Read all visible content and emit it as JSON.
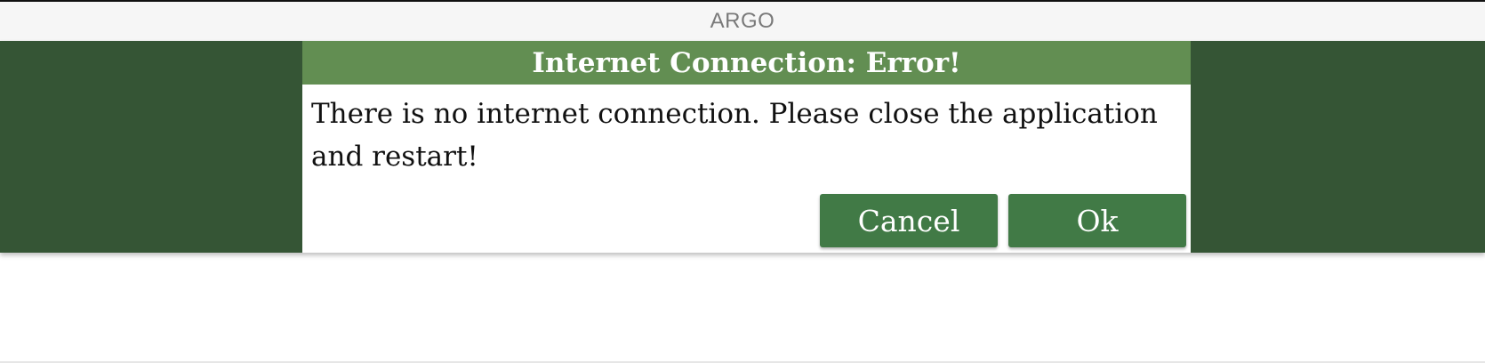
{
  "window": {
    "title": "ARGO"
  },
  "colors": {
    "app_background": "#355535",
    "dialog_header": "#628e52",
    "button": "#417a46"
  },
  "dialog": {
    "title": "Internet Connection: Error!",
    "message": "There is no internet connection. Please close the application and restart!",
    "buttons": {
      "cancel_label": "Cancel",
      "ok_label": "Ok"
    }
  }
}
